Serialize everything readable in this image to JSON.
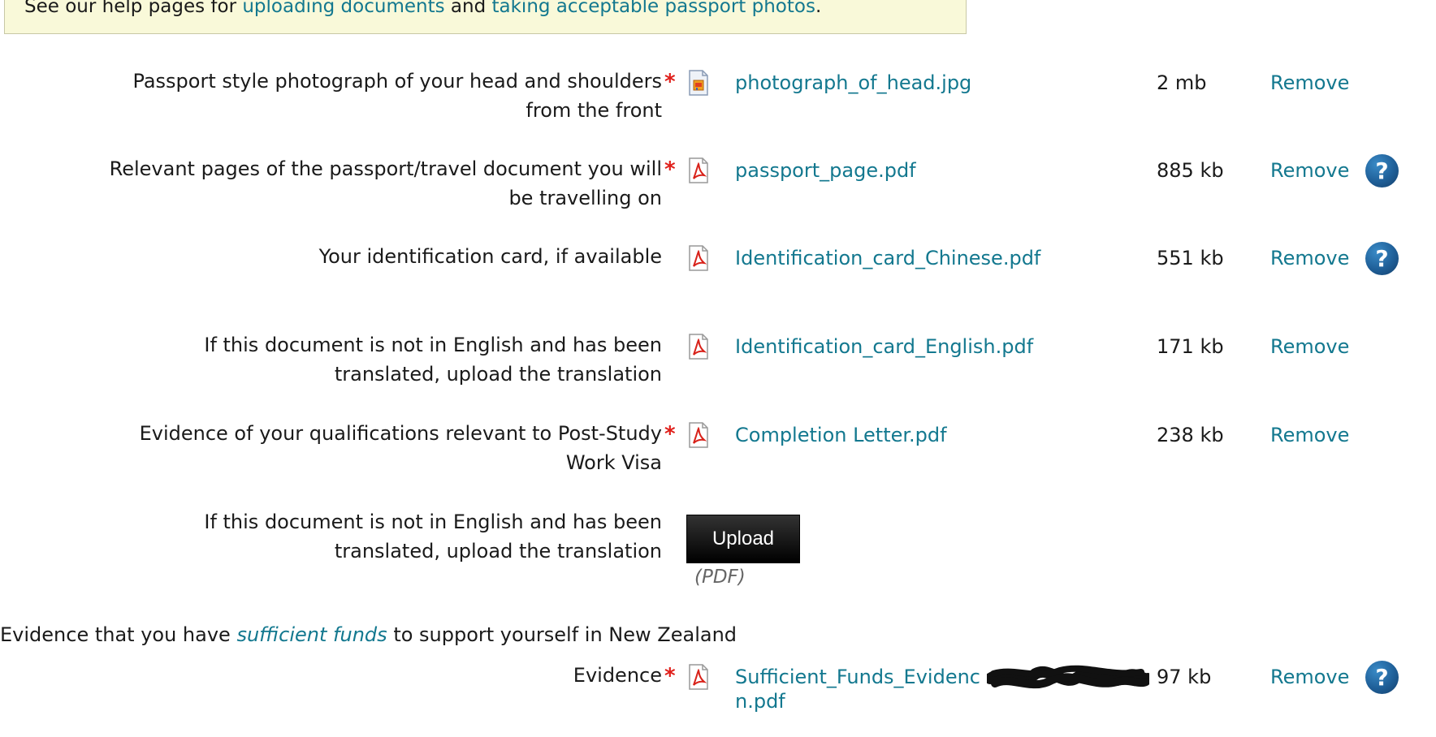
{
  "help_box": {
    "prefix": "See our help pages for",
    "link1": "uploading documents",
    "middle": "and",
    "link2": "taking acceptable passport photos",
    "suffix": "."
  },
  "rows": [
    {
      "label": "Passport style photograph of your head and shoulders from the front",
      "required": "*",
      "icon": "image-file-icon",
      "file_name": "photograph_of_head.jpg",
      "file_size": "2 mb",
      "remove": "Remove"
    },
    {
      "label": "Relevant pages of the passport/travel document you will be travelling on",
      "required": "*",
      "icon": "pdf-file-icon",
      "file_name": "passport_page.pdf",
      "file_size": "885 kb",
      "remove": "Remove",
      "help": "?"
    },
    {
      "label": "Your identification card, if available",
      "icon": "pdf-file-icon",
      "file_name": "Identification_card_Chinese.pdf",
      "file_size": "551 kb",
      "remove": "Remove",
      "help": "?"
    },
    {
      "label": "If this document is not in English and has been translated, upload the translation",
      "icon": "pdf-file-icon",
      "file_name": "Identification_card_English.pdf",
      "file_size": "171 kb",
      "remove": "Remove"
    },
    {
      "label": "Evidence of your qualifications relevant to Post-Study Work Visa",
      "required": "*",
      "icon": "pdf-file-icon",
      "file_name": "Completion Letter.pdf",
      "file_size": "238 kb",
      "remove": "Remove"
    },
    {
      "label": "If this document is not in English and has been translated, upload the translation",
      "upload_label": "Upload",
      "upload_hint": "(PDF)"
    }
  ],
  "funds_section": {
    "prefix": "Evidence that you have",
    "link": "sufficient funds",
    "suffix": "to support yourself in New Zealand"
  },
  "funds_row": {
    "label": "Evidence",
    "required": "*",
    "icon": "pdf-file-icon",
    "file_name_line1": "Sufficient_Funds_Evidenc",
    "file_name_line2": "n.pdf",
    "file_size": "97 kb",
    "remove": "Remove",
    "help": "?"
  },
  "colors": {
    "link": "#13788f",
    "required": "#e0201b",
    "help_box_bg": "#f9f9d9",
    "help_icon": "#1f5f98"
  }
}
